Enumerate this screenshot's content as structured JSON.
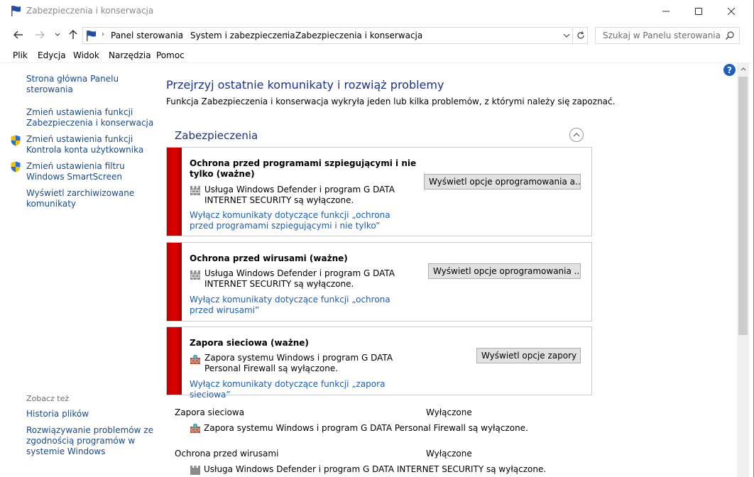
{
  "window": {
    "title": "Zabezpieczenia i konserwacja"
  },
  "address": {
    "breadcrumbs": [
      "Panel sterowania",
      "System i zabezpieczenia",
      "Zabezpieczenia i konserwacja"
    ],
    "search_placeholder": "Szukaj w Panelu sterowania"
  },
  "menu": {
    "items": [
      "Plik",
      "Edycja",
      "Widok",
      "Narzędzia",
      "Pomoc"
    ]
  },
  "sidebar": {
    "links": [
      "Strona główna Panelu sterowania",
      "Zmień ustawienia funkcji Zabezpieczenia i konserwacja",
      "Zmień ustawienia funkcji Kontrola konta użytkownika",
      "Zmień ustawienia filtru Windows SmartScreen",
      "Wyświetl zarchiwizowane komunikaty"
    ],
    "see_also_heading": "Zobacz też",
    "see_also": [
      "Historia plików",
      "Rozwiązywanie problemów ze zgodnością programów w systemie Windows"
    ]
  },
  "main": {
    "title": "Przejrzyj ostatnie komunikaty i rozwiąż problemy",
    "description": "Funkcja Zabezpieczenia i konserwacja wykryła jeden lub kilka problemów, z którymi należy się zapoznać.",
    "section_title": "Zabezpieczenia",
    "cards": [
      {
        "title": "Ochrona przed programami szpiegującymi i nie tylko (ważne)",
        "text": "Usługa Windows Defender i program G DATA INTERNET SECURITY są wyłączone.",
        "link": "Wyłącz komunikaty dotyczące funkcji „ochrona przed programami szpiegującymi i nie tylko”",
        "button": "Wyświetl opcje oprogramowania a..."
      },
      {
        "title": "Ochrona przed wirusami  (ważne)",
        "text": "Usługa Windows Defender i program G DATA INTERNET SECURITY są wyłączone.",
        "link": "Wyłącz komunikaty dotyczące funkcji „ochrona przed wirusami”",
        "button": "Wyświetl opcje oprogramowania ..."
      },
      {
        "title": "Zapora sieciowa  (ważne)",
        "text": "Zapora systemu Windows i program G DATA Personal Firewall są wyłączone.",
        "link": "Wyłącz komunikaty dotyczące funkcji „zapora sieciowa”",
        "button": "Wyświetl opcje zapory"
      }
    ],
    "status_rows": [
      {
        "label": "Zapora sieciowa",
        "value": "Wyłączone",
        "detail": "Zapora systemu Windows i program G DATA Personal Firewall są wyłączone."
      },
      {
        "label": "Ochrona przed wirusami",
        "value": "Wyłączone",
        "detail": "Usługa Windows Defender i program G DATA INTERNET SECURITY są wyłączone."
      }
    ]
  },
  "colors": {
    "link": "#1a5db5",
    "heading": "#1e3287",
    "alert_bar": "#d00000"
  }
}
